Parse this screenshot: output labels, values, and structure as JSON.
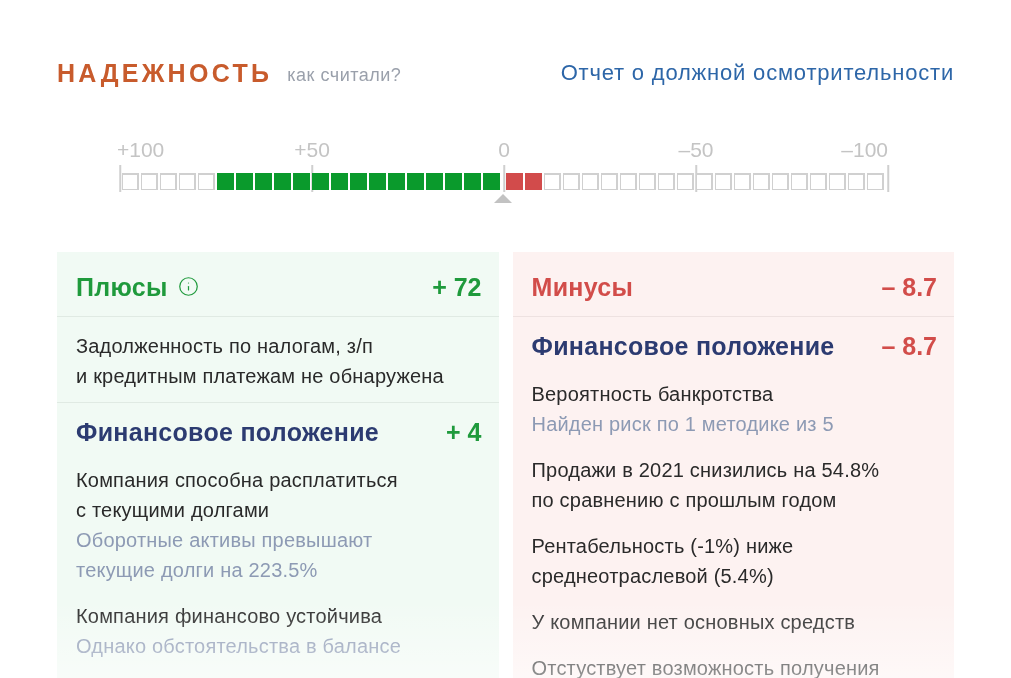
{
  "header": {
    "title": "НАДЕЖНОСТЬ",
    "help_link": "как считали?",
    "report_link": "Отчет о должной осмотрительности"
  },
  "scale": {
    "ticks": [
      "+100",
      "+50",
      "0",
      "–50",
      "–100"
    ],
    "positive": {
      "level": 0.75
    },
    "negative": {
      "level": 0.1
    }
  },
  "panels": [
    {
      "kind": "pros",
      "title": "Плюсы",
      "info_icon": true,
      "score": "+ 72",
      "sections": [
        {
          "kind": "plain",
          "items": [
            {
              "text": "Задолженность по налогам, з/п\nи кредитным платежам не обнаружена"
            }
          ]
        },
        {
          "kind": "group",
          "title": "Финансовое положение",
          "score": "+ 4",
          "items": [
            {
              "text": "Компания способна расплатиться\nс текущими долгами",
              "note": "Оборотные активы превышают\nтекущие долги на 223.5%"
            },
            {
              "text": "Компания финансово устойчива",
              "note": "Однако обстоятельства в балансе"
            }
          ]
        }
      ]
    },
    {
      "kind": "cons",
      "title": "Минусы",
      "info_icon": false,
      "score": "– 8.7",
      "sections": [
        {
          "kind": "group",
          "title": "Финансовое положение",
          "score": "– 8.7",
          "items": [
            {
              "text": "Вероятность банкротства",
              "note": "Найден риск по 1 методике из 5"
            },
            {
              "text": "Продажи в 2021 снизились на 54.8%\nпо сравнению с прошлым годом"
            },
            {
              "text": "Рентабельность (-1%) ниже\nсреднеотраслевой (5.4%)"
            },
            {
              "text": "У компании нет основных средств"
            },
            {
              "text": "Отстуствует возможность получения"
            }
          ]
        }
      ]
    }
  ]
}
